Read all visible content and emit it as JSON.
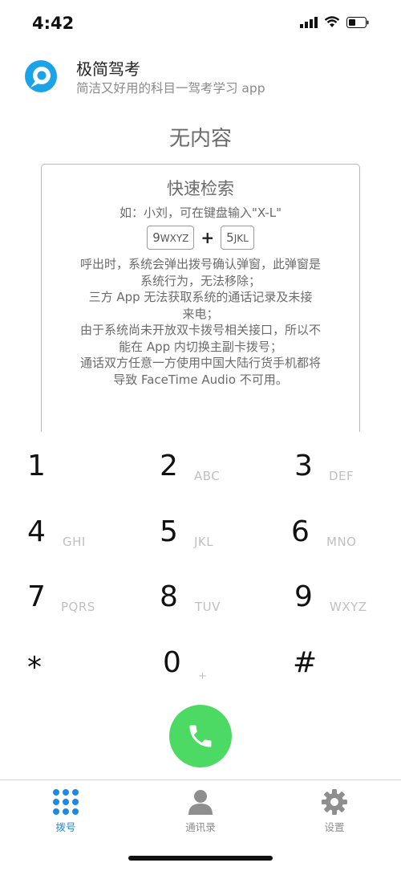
{
  "status": {
    "time": "4:42",
    "icons": [
      "signal-icon",
      "wifi-icon",
      "battery-icon"
    ]
  },
  "banner": {
    "title": "极简驾考",
    "subtitle": "简洁又好用的科目一驾考学习 app",
    "logo_icon": "app-logo-icon",
    "logo_color": "#1aa3e8"
  },
  "empty_title": "无内容",
  "help": {
    "title": "快速检索",
    "example": "如：小刘，可在键盘输入\"X-L\"",
    "key1_digit": "9",
    "key1_letters": "WXYZ",
    "plus": "+",
    "key2_digit": "5",
    "key2_letters": "JKL",
    "notes": [
      "呼出时，系统会弹出拨号确认弹窗，此弹窗是",
      "系统行为，无法移除；",
      "三方 App 无法获取系统的通话记录及未接",
      "来电；",
      "由于系统尚未开放双卡拨号相关接口，所以不",
      "能在 App 内切换主副卡拨号；",
      "通话双方任意一方使用中国大陆行货手机都将",
      "导致 FaceTime Audio 不可用。"
    ]
  },
  "keypad": [
    {
      "digit": "1",
      "letters": ""
    },
    {
      "digit": "2",
      "letters": "ABC"
    },
    {
      "digit": "3",
      "letters": "DEF"
    },
    {
      "digit": "4",
      "letters": "GHI"
    },
    {
      "digit": "5",
      "letters": "JKL"
    },
    {
      "digit": "6",
      "letters": "MNO"
    },
    {
      "digit": "7",
      "letters": "PQRS"
    },
    {
      "digit": "8",
      "letters": "TUV"
    },
    {
      "digit": "9",
      "letters": "WXYZ"
    },
    {
      "digit": "*",
      "letters": ""
    },
    {
      "digit": "0",
      "letters": "+"
    },
    {
      "digit": "#",
      "letters": ""
    }
  ],
  "call_button": {
    "icon": "phone-icon",
    "color": "#4cd964"
  },
  "tabs": [
    {
      "label": "拨号",
      "icon": "dialpad-icon",
      "active": true
    },
    {
      "label": "通讯录",
      "icon": "contacts-icon",
      "active": false
    },
    {
      "label": "设置",
      "icon": "gear-icon",
      "active": false
    }
  ],
  "colors": {
    "accent": "#1e88e5",
    "inactive": "#8e8e8e"
  }
}
